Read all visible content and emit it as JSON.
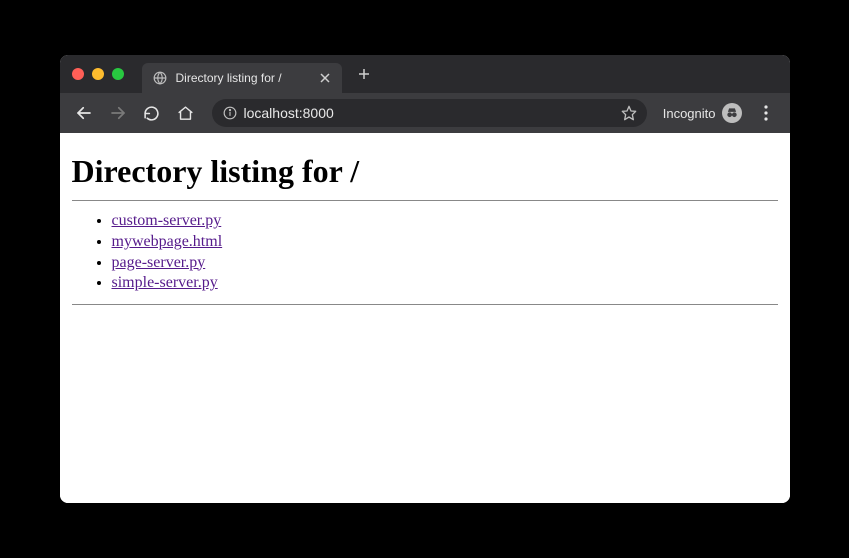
{
  "tab": {
    "title": "Directory listing for /"
  },
  "toolbar": {
    "url": "localhost:8000",
    "incognito_label": "Incognito"
  },
  "page": {
    "heading": "Directory listing for /",
    "files": [
      "custom-server.py",
      "mywebpage.html",
      "page-server.py",
      "simple-server.py"
    ]
  }
}
